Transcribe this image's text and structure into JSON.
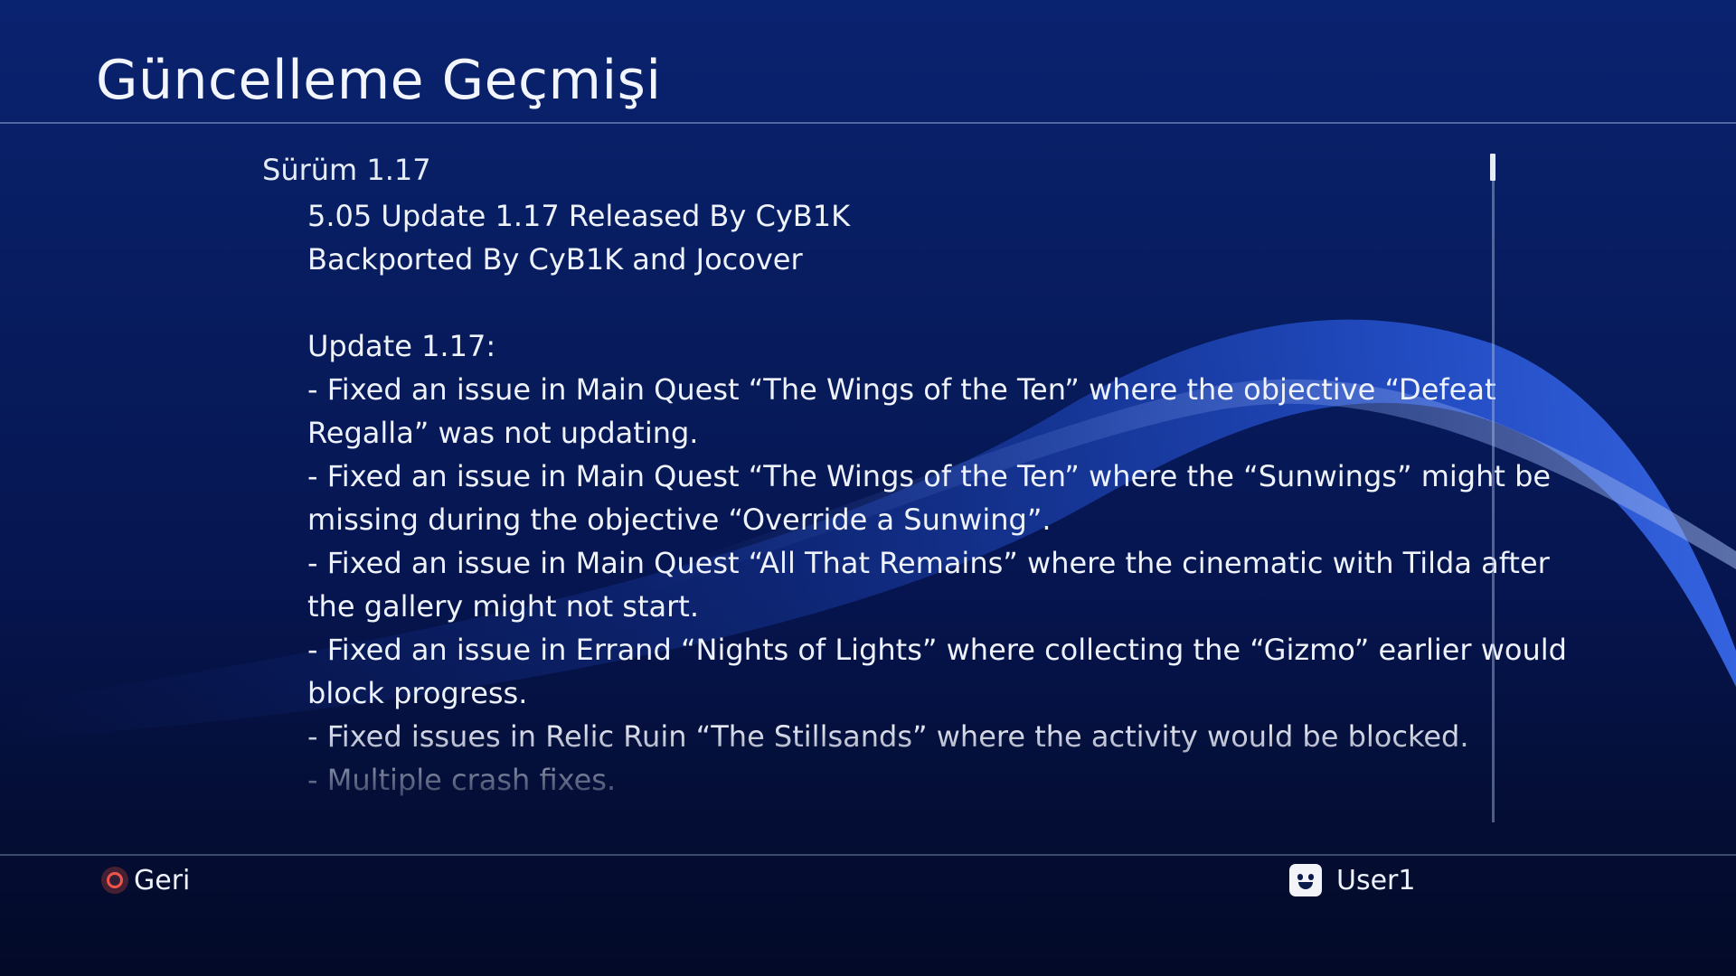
{
  "header": {
    "title": "Güncelleme Geçmişi"
  },
  "release": {
    "version_heading": "Sürüm 1.17",
    "notes": [
      "5.05 Update 1.17 Released By CyB1K",
      "Backported By CyB1K and Jocover",
      "",
      "Update 1.17:",
      "- Fixed an issue in Main Quest “The Wings of the Ten” where the objective “Defeat",
      "Regalla” was not updating.",
      "- Fixed an issue in Main Quest “The Wings of the Ten” where the “Sunwings” might be",
      "missing during the objective “Override a Sunwing”.",
      "- Fixed an issue in Main Quest “All That Remains” where the cinematic with Tilda after",
      "the gallery might not start.",
      "- Fixed an issue in Errand “Nights of Lights” where collecting the “Gizmo” earlier would",
      "block progress.",
      "- Fixed issues in Relic Ruin “The Stillsands” where the activity would be blocked.",
      "- Multiple crash fixes."
    ]
  },
  "footer": {
    "back_label": "Geri",
    "back_icon": "circle-button-icon",
    "user_name": "User1",
    "user_icon": "avatar-icon"
  },
  "colors": {
    "accent_circle": "#f0554a",
    "background_top": "#0a2370",
    "background_bottom": "#030a28"
  }
}
